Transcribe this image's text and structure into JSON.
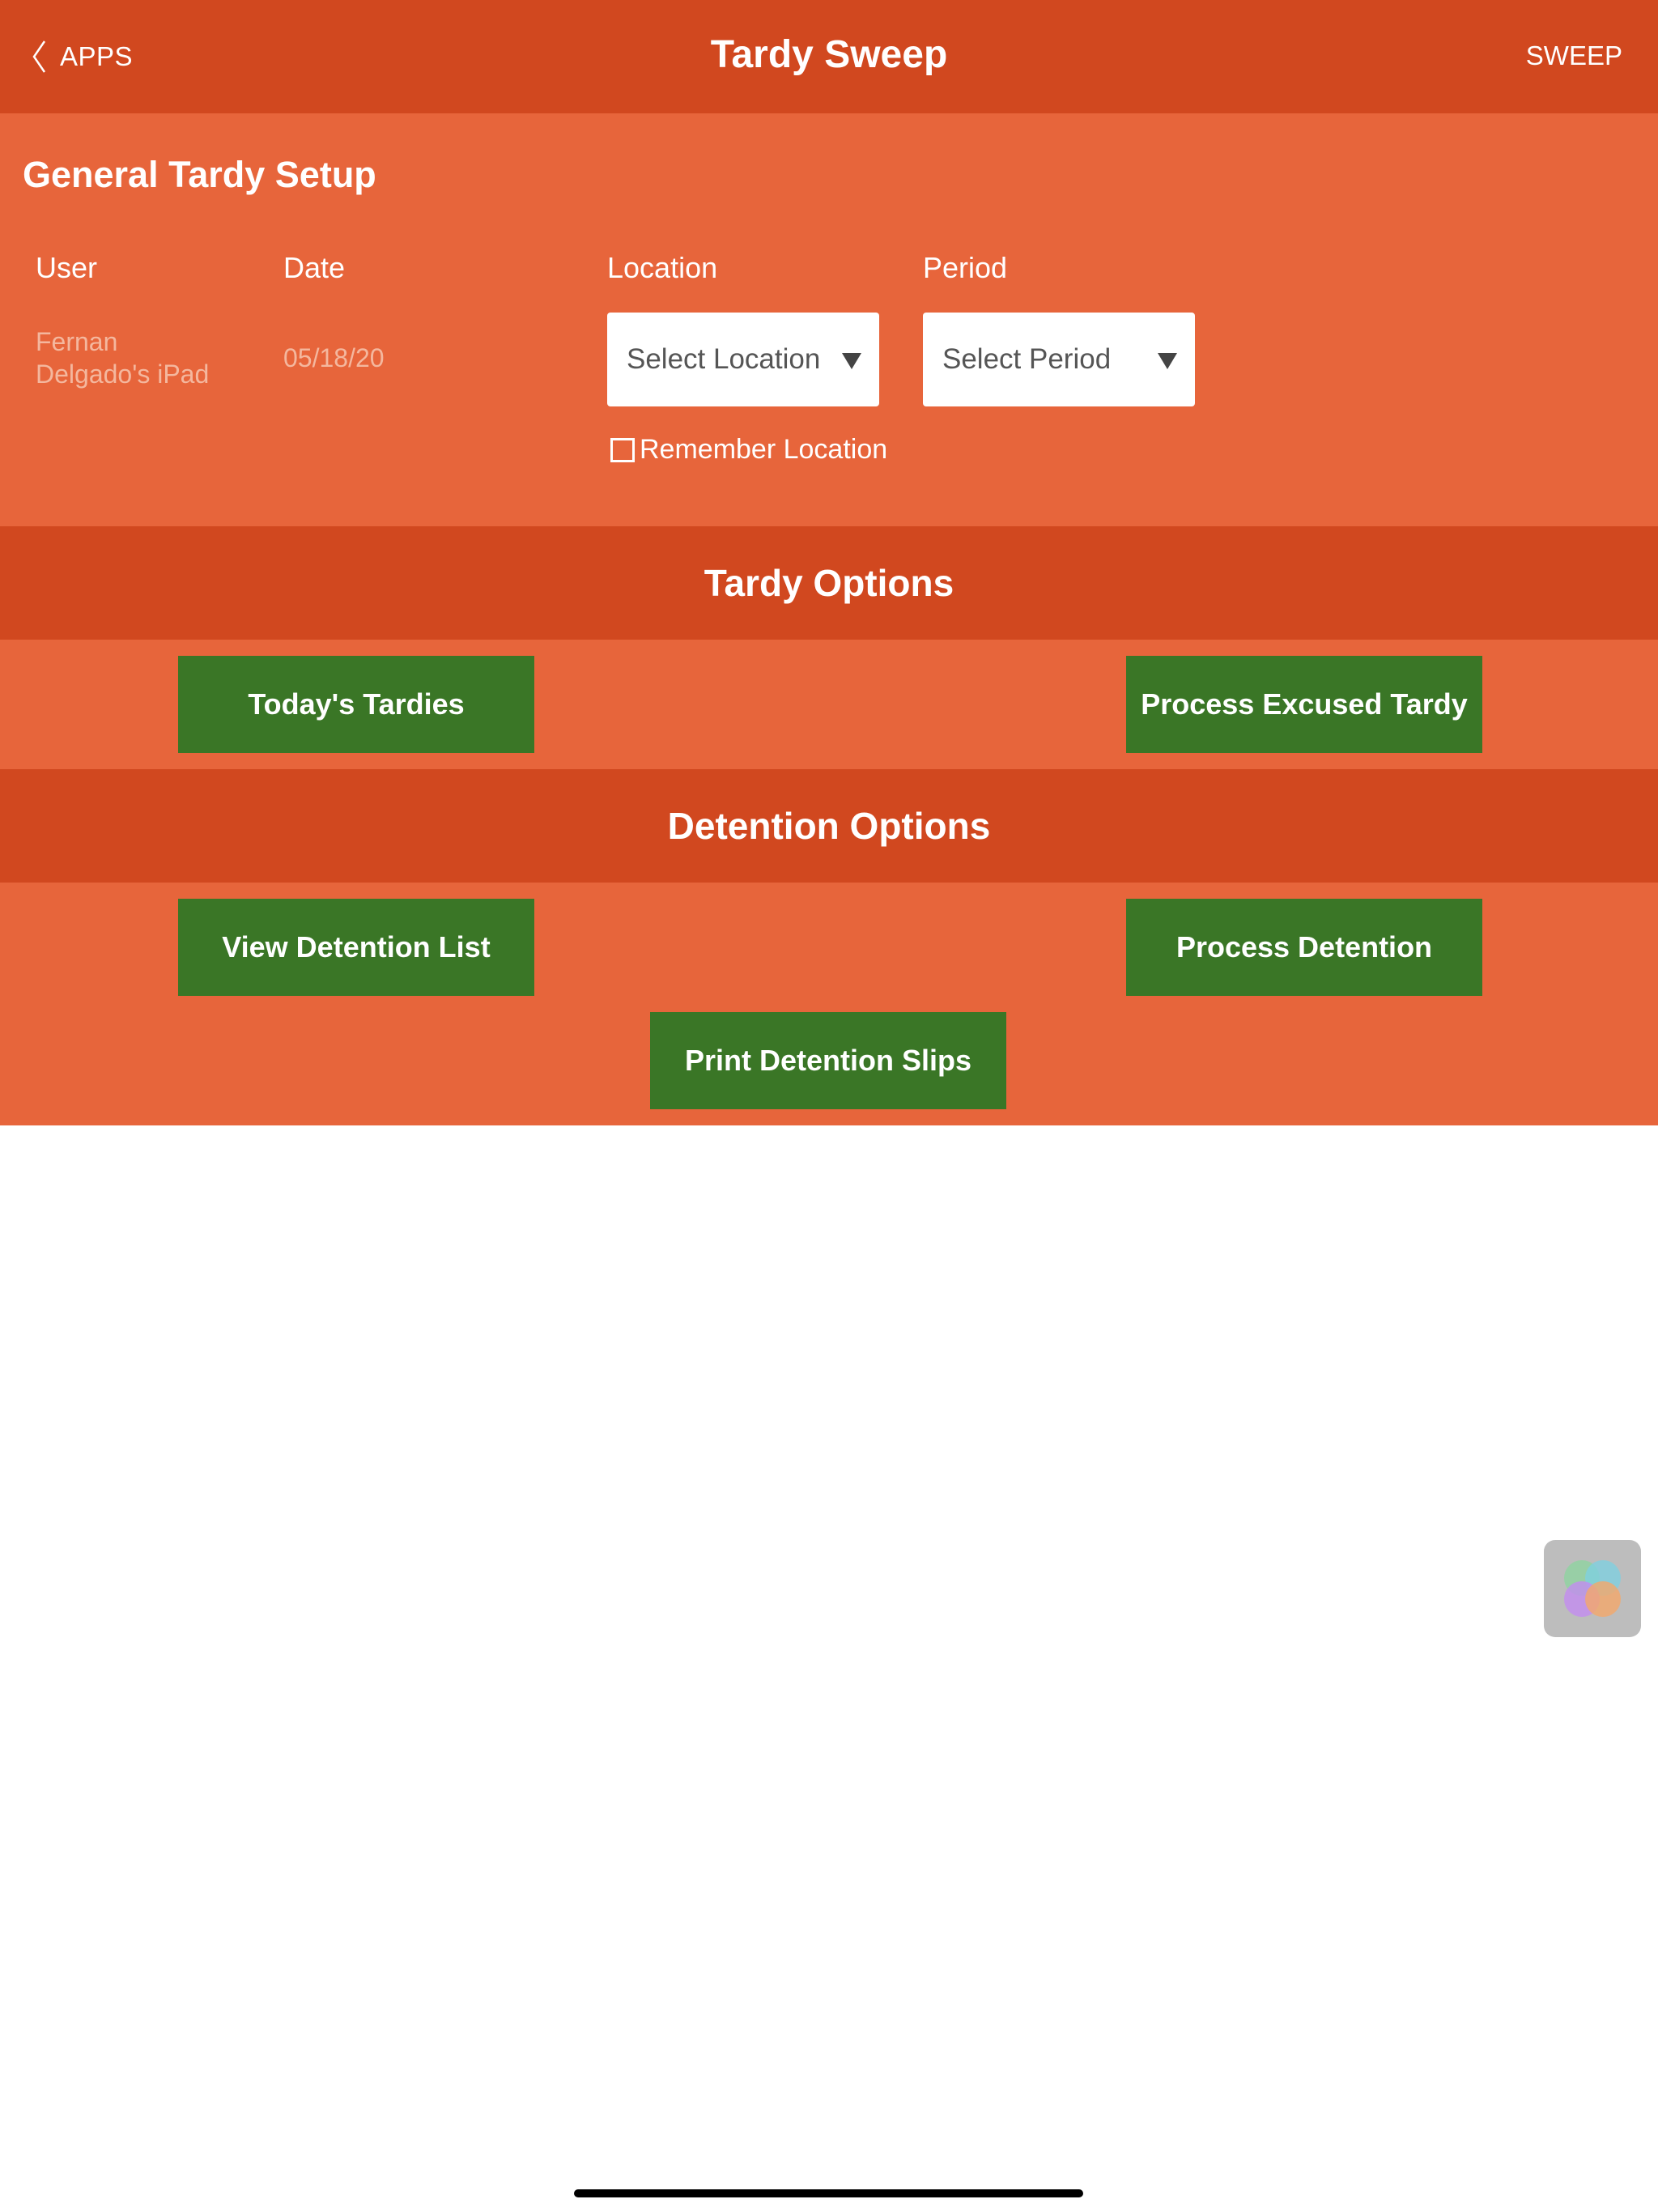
{
  "header": {
    "back_label": "APPS",
    "title": "Tardy Sweep",
    "action_label": "SWEEP"
  },
  "setup": {
    "title": "General Tardy Setup",
    "user_label": "User",
    "date_label": "Date",
    "location_label": "Location",
    "period_label": "Period",
    "user_value_line1": "Fernan",
    "user_value_line2": "Delgado's iPad",
    "date_value": "05/18/20",
    "location_placeholder": "Select Location",
    "period_placeholder": "Select Period",
    "remember_label": "Remember Location",
    "remember_checked": false
  },
  "tardy_options": {
    "title": "Tardy Options",
    "todays_tardies": "Today's Tardies",
    "process_excused": "Process Excused Tardy"
  },
  "detention_options": {
    "title": "Detention Options",
    "view_list": "View Detention List",
    "process": "Process Detention",
    "print_slips": "Print Detention Slips"
  },
  "colors": {
    "header_bg": "#d1481f",
    "panel_bg": "#e7653b",
    "button_bg": "#3a7626",
    "muted_text": "#f4b79e"
  },
  "icons": {
    "back": "chevron-left-icon",
    "dropdown": "triangle-down-icon",
    "widget": "assistive-touch-icon"
  }
}
